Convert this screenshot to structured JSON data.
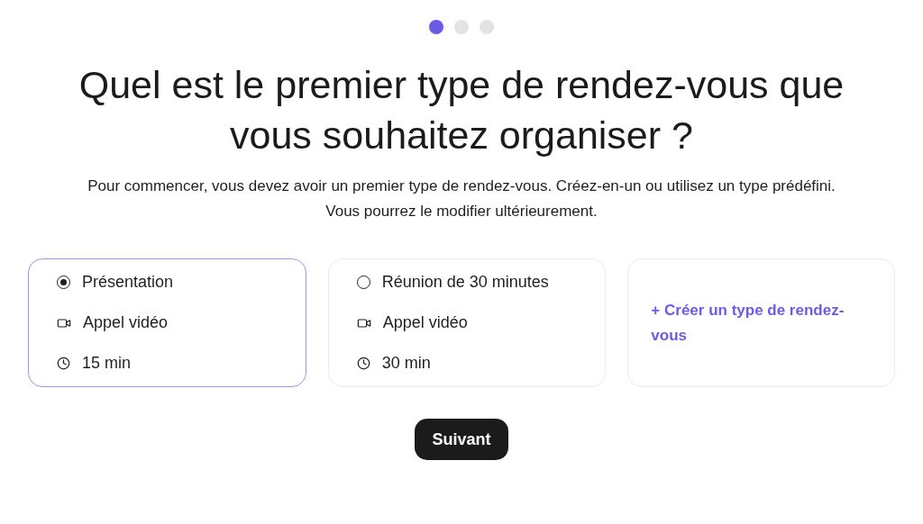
{
  "steps": [
    {
      "selected": true
    },
    {
      "selected": false
    },
    {
      "selected": false
    }
  ],
  "title": "Quel est le premier type de rendez-vous que vous souhaitez organiser ?",
  "description": "Pour commencer, vous devez avoir un premier type de rendez-vous. Créez-en-un ou utilisez un type prédéfini.",
  "note": "Vous pourrez le modifier ultérieurement.",
  "options": [
    {
      "kind": "preset",
      "selected": true,
      "name": "Présentation",
      "location": "Appel vidéo",
      "duration": "15 min"
    },
    {
      "kind": "preset",
      "selected": false,
      "name": "Réunion de 30 minutes",
      "location": "Appel vidéo",
      "duration": "30 min"
    },
    {
      "kind": "create",
      "label": "+ Créer un type de rendez-vous"
    }
  ],
  "next_button": "Suivant"
}
